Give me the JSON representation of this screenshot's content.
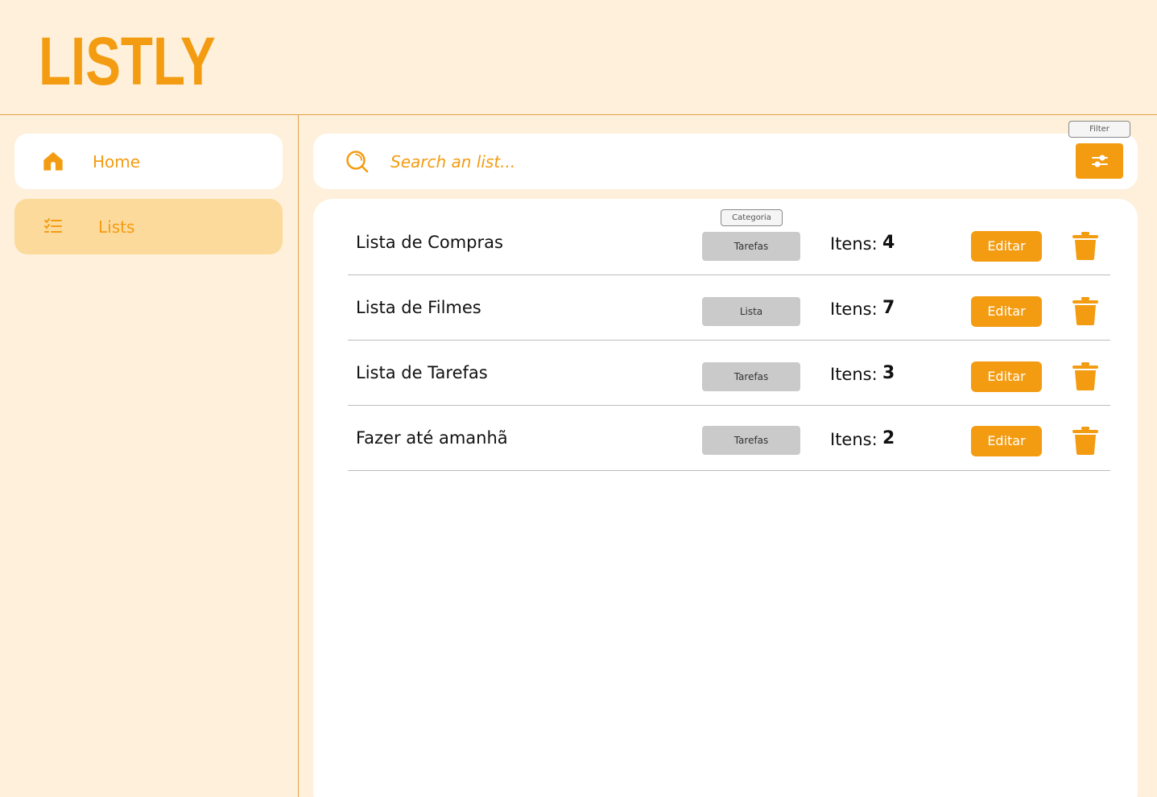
{
  "app": {
    "logo": "LISTLY"
  },
  "sidebar": {
    "items": [
      {
        "label": "Home",
        "icon": "home-icon",
        "active": false
      },
      {
        "label": "Lists",
        "icon": "checklist-icon",
        "active": true
      }
    ]
  },
  "search": {
    "placeholder": "Search an list...",
    "value": ""
  },
  "filter": {
    "tooltip": "Filter",
    "icon": "sliders-icon"
  },
  "table": {
    "category_tooltip": "Categoria",
    "items_label": "Itens:",
    "edit_label": "Editar",
    "rows": [
      {
        "name": "Lista de Compras",
        "category": "Tarefas",
        "count": "4"
      },
      {
        "name": "Lista de Filmes",
        "category": "Lista",
        "count": "7"
      },
      {
        "name": "Lista de Tarefas",
        "category": "Tarefas",
        "count": "3"
      },
      {
        "name": "Fazer até amanhã",
        "category": "Tarefas",
        "count": "2"
      }
    ]
  },
  "colors": {
    "accent": "#F39C12",
    "background": "#FEF0DA",
    "active_nav": "#FCDA9C",
    "surface": "#FFFFFF",
    "chip": "#CACACA"
  }
}
